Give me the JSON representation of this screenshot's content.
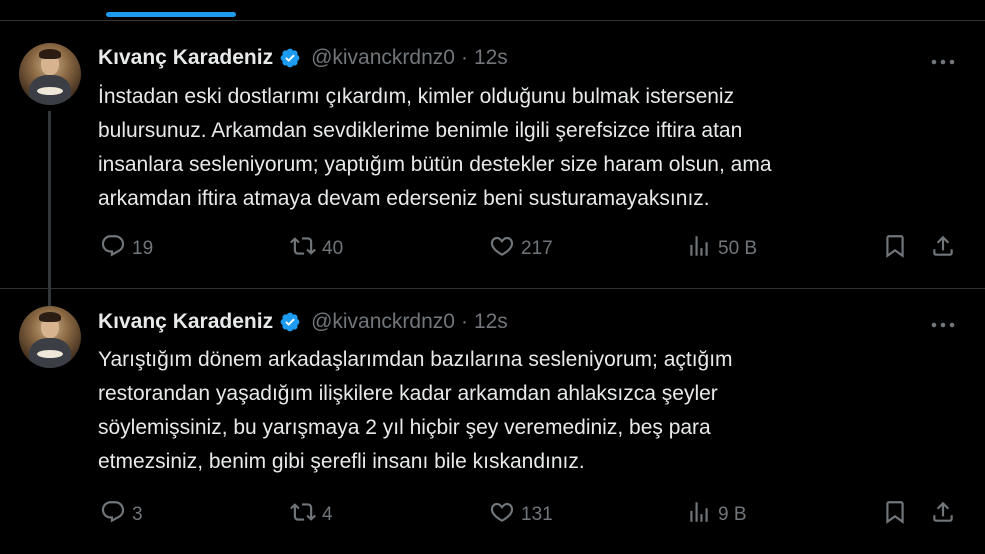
{
  "colors": {
    "background": "#000000",
    "text": "#e7e9ea",
    "muted": "#71767b",
    "accent": "#1d9bf0",
    "divider": "#2f3336"
  },
  "tweets": [
    {
      "author": {
        "name": "Kıvanç Karadeniz",
        "handle": "@kivanckrdnz0",
        "verified": true,
        "avatar_icon": "profile-photo"
      },
      "time": "12s",
      "text": "İnstadan eski dostlarımı çıkardım, kimler olduğunu bulmak isterseniz\nbulursunuz. Arkamdan sevdiklerime benimle ilgili şerefsizce iftira atan\ninsanlara sesleniyorum; yaptığım bütün destekler size haram olsun, ama\narkamdan iftira atmaya devam ederseniz beni susturamayaksınız.",
      "stats": {
        "replies": "19",
        "reposts": "40",
        "likes": "217",
        "views": "50 B"
      }
    },
    {
      "author": {
        "name": "Kıvanç Karadeniz",
        "handle": "@kivanckrdnz0",
        "verified": true,
        "avatar_icon": "profile-photo"
      },
      "time": "12s",
      "text": "Yarıştığım dönem arkadaşlarımdan bazılarına sesleniyorum; açtığım\nrestorandan yaşadığım ilişkilere kadar arkamdan ahlaksızca şeyler\nsöylemişsiniz, bu yarışmaya 2 yıl hiçbir şey veremediniz, beş para\netmezsiniz, benim gibi şerefli insanı bile kıskandınız.",
      "stats": {
        "replies": "3",
        "reposts": "4",
        "likes": "131",
        "views": "9 B"
      }
    }
  ],
  "separator": "·"
}
